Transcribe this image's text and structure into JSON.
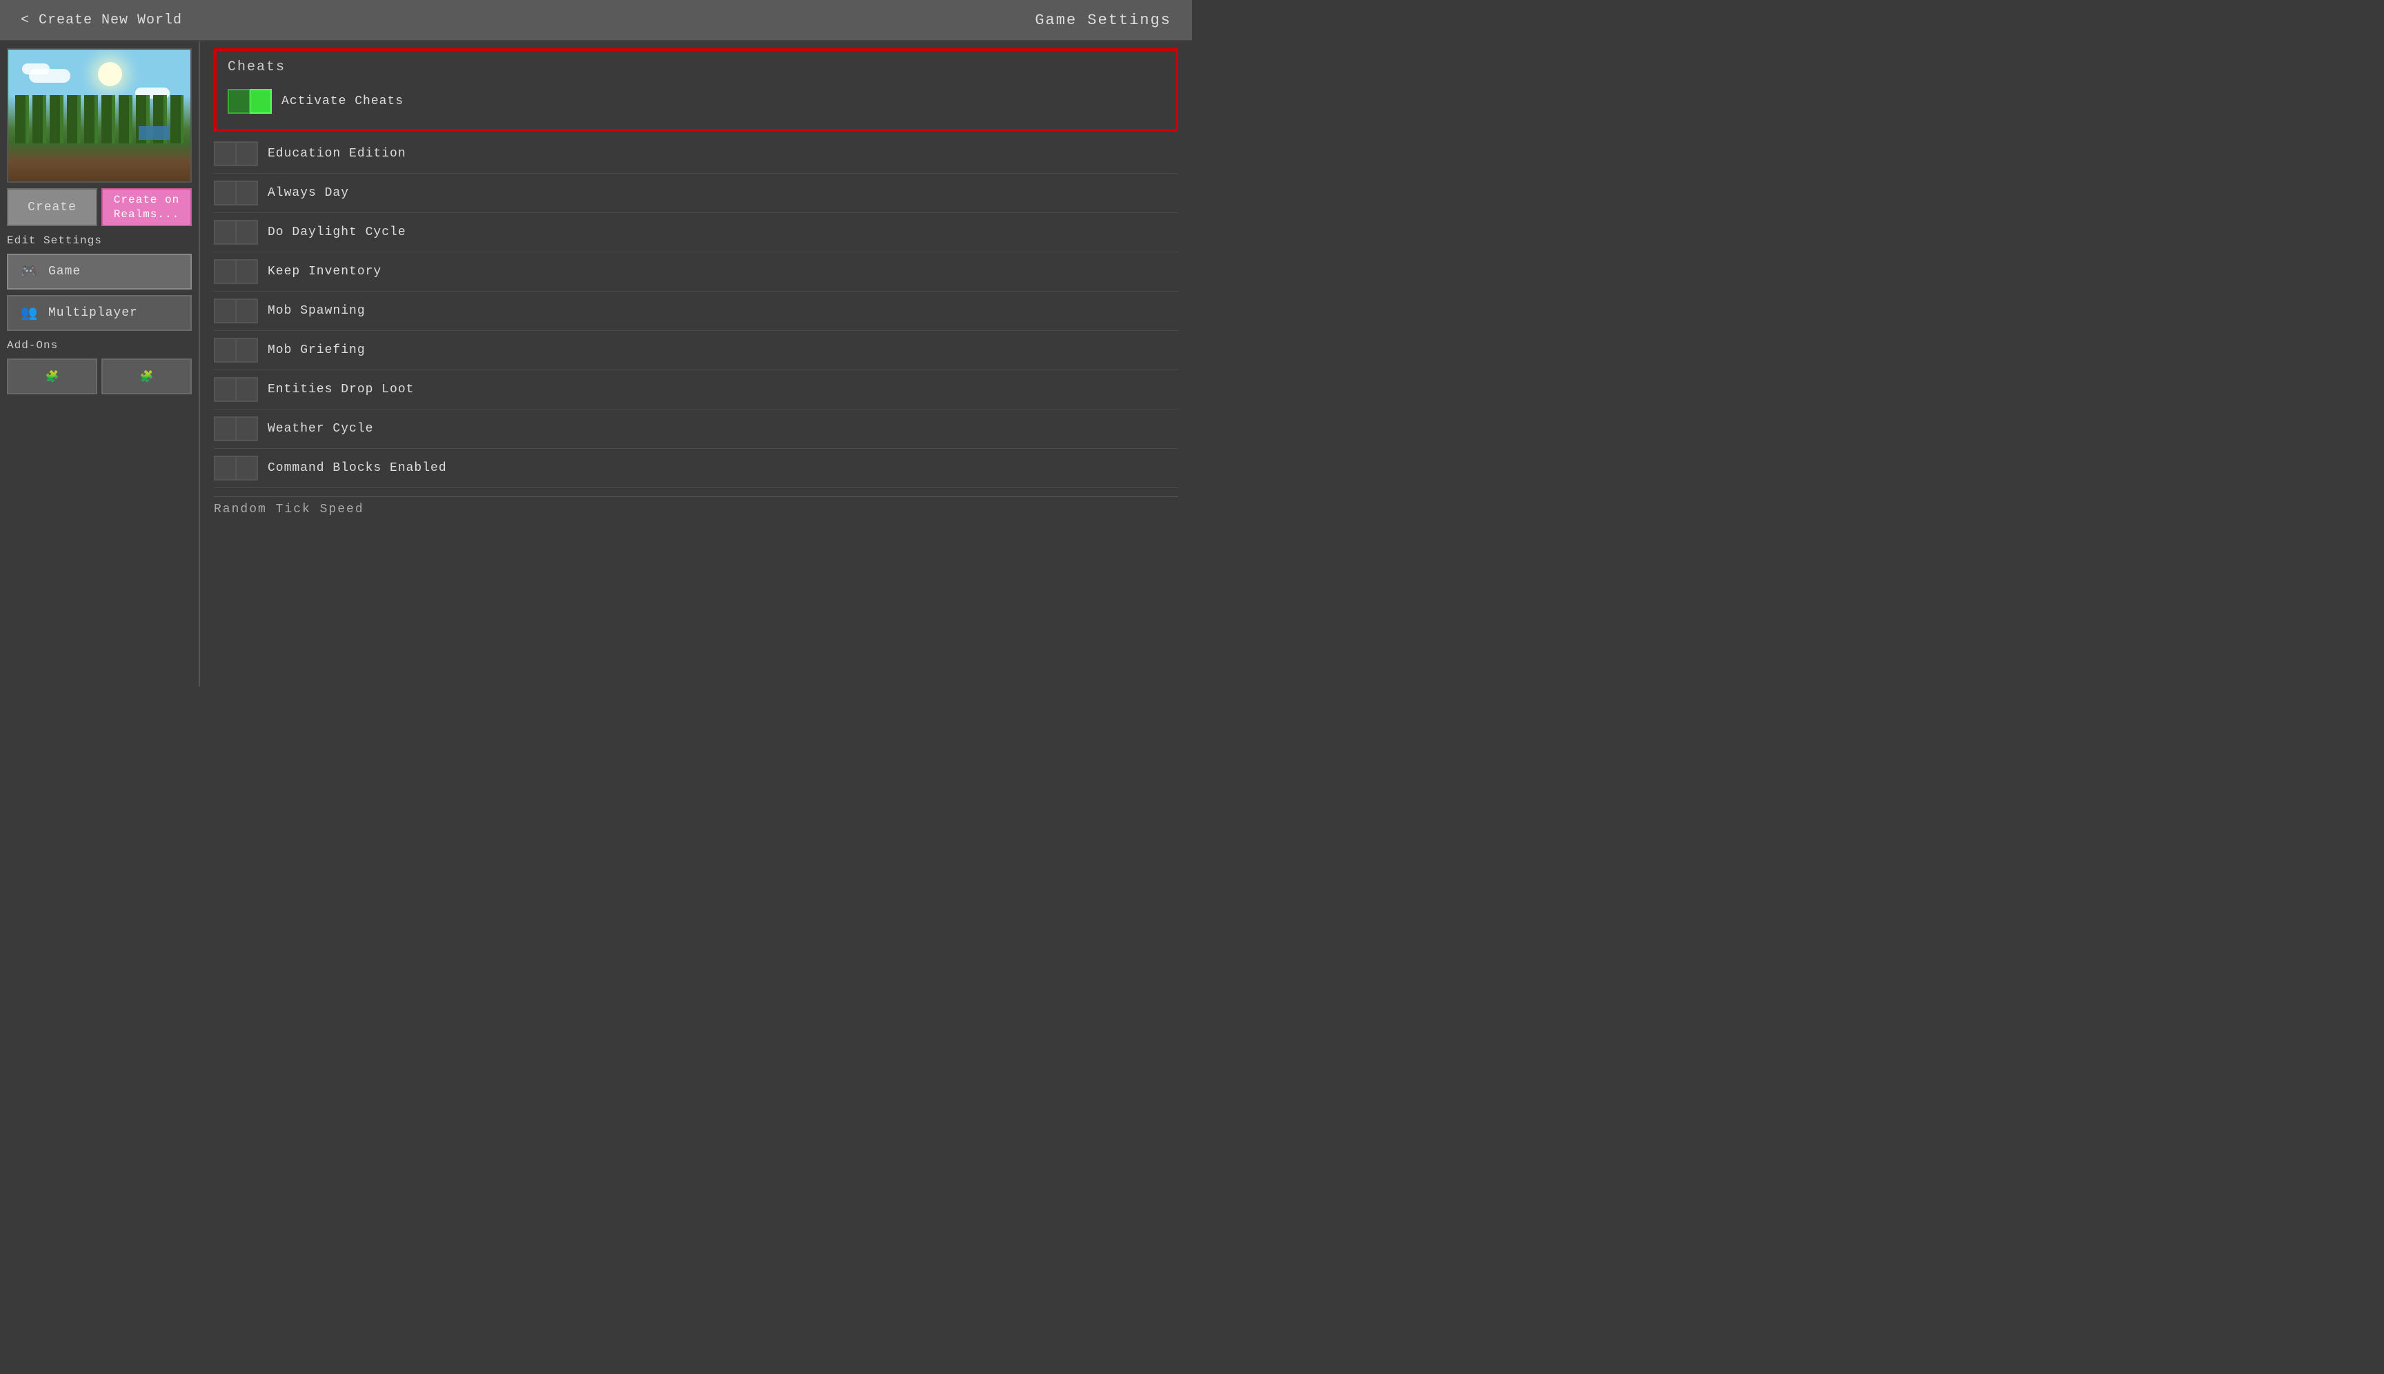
{
  "header": {
    "back_label": "< Create New World",
    "title": "Game Settings"
  },
  "left_panel": {
    "create_button": "Create",
    "create_realms_button": "Create on\nRealms...",
    "edit_settings_label": "Edit Settings",
    "nav_items": [
      {
        "id": "game",
        "label": "Game",
        "icon": "🎮",
        "active": true
      },
      {
        "id": "multiplayer",
        "label": "Multiplayer",
        "icon": "👥",
        "active": false
      }
    ],
    "addons_label": "Add-Ons"
  },
  "right_panel": {
    "cheats_section": {
      "title": "Cheats",
      "activate_cheats": {
        "label": "Activate Cheats",
        "enabled": true
      }
    },
    "game_rules": [
      {
        "id": "education_edition",
        "label": "Education Edition",
        "enabled": false
      },
      {
        "id": "always_day",
        "label": "Always Day",
        "enabled": false
      },
      {
        "id": "do_daylight_cycle",
        "label": "Do Daylight Cycle",
        "enabled": false
      },
      {
        "id": "keep_inventory",
        "label": "Keep Inventory",
        "enabled": false
      },
      {
        "id": "mob_spawning",
        "label": "Mob Spawning",
        "enabled": false
      },
      {
        "id": "mob_griefing",
        "label": "Mob Griefing",
        "enabled": false
      },
      {
        "id": "entities_drop_loot",
        "label": "Entities Drop Loot",
        "enabled": false
      },
      {
        "id": "weather_cycle",
        "label": "Weather Cycle",
        "enabled": false
      },
      {
        "id": "command_blocks_enabled",
        "label": "Command Blocks Enabled",
        "enabled": false
      }
    ],
    "random_tick_speed_label": "Random Tick Speed"
  }
}
